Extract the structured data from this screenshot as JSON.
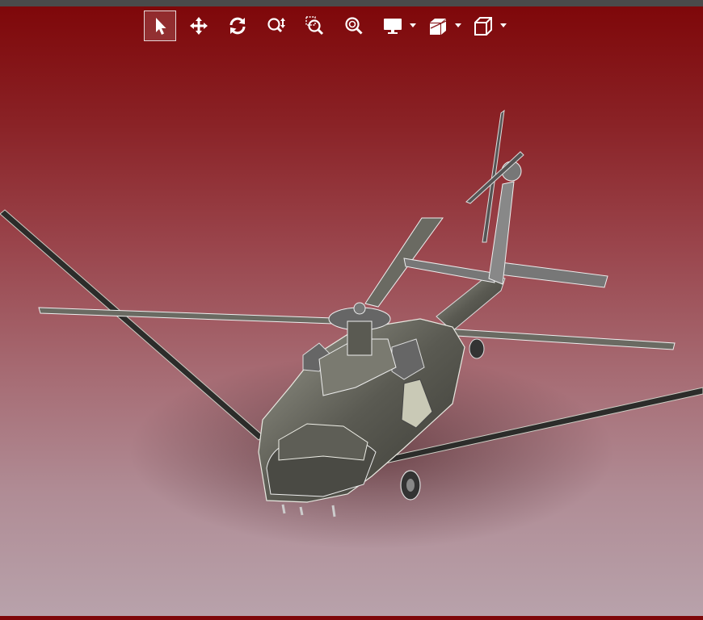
{
  "toolbar": {
    "tools": [
      {
        "name": "select-tool",
        "icon": "pointer-arrow-icon",
        "active": true
      },
      {
        "name": "pan-tool",
        "icon": "move-arrows-icon",
        "active": false
      },
      {
        "name": "rotate-tool",
        "icon": "rotate-icon",
        "active": false
      },
      {
        "name": "zoom-tool",
        "icon": "zoom-updown-icon",
        "active": false
      },
      {
        "name": "zoom-window-tool",
        "icon": "zoom-window-icon",
        "active": false
      },
      {
        "name": "zoom-fit-tool",
        "icon": "zoom-fit-icon",
        "active": false
      },
      {
        "name": "display-mode-dropdown",
        "icon": "monitor-icon",
        "active": false,
        "dropdown": true
      },
      {
        "name": "section-dropdown",
        "icon": "section-cube-icon",
        "active": false,
        "dropdown": true
      },
      {
        "name": "view-orientation-dropdown",
        "icon": "cube-icon",
        "active": false,
        "dropdown": true
      }
    ],
    "icon_color": "#ffffff",
    "active_border": "#e6d9d9"
  },
  "viewport": {
    "model": "helicopter-model",
    "background_top": "#7e0608",
    "background_bottom": "#b8a2ab"
  }
}
